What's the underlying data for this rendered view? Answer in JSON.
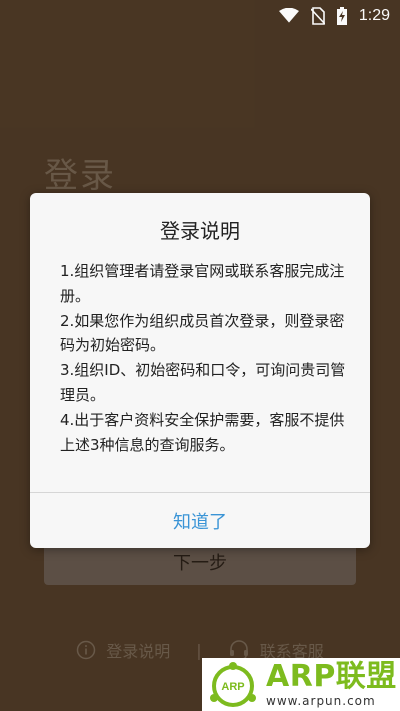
{
  "status_bar": {
    "time": "1:29"
  },
  "login": {
    "title": "登录",
    "next_button": "下一步",
    "links": {
      "instructions": "登录说明",
      "separator": "|",
      "support": "联系客服"
    }
  },
  "dialog": {
    "title": "登录说明",
    "lines": [
      "1.组织管理者请登录官网或联系客服完成注册。",
      "2.如果您作为组织成员首次登录，则登录密码为初始密码。",
      "3.组织ID、初始密码和口令，可询问贵司管理员。",
      "4.出于客户资料安全保护需要，客服不提供上述3种信息的查询服务。"
    ],
    "ok_button": "知道了"
  },
  "watermark": {
    "logo_text": "ARP",
    "brand": "ARP联盟",
    "url": "www.arpun.com"
  },
  "colors": {
    "background": "#4a3724",
    "dialog_bg": "#f7f7f7",
    "accent": "#3a94d6",
    "brand_green": "#7dbb1e"
  }
}
